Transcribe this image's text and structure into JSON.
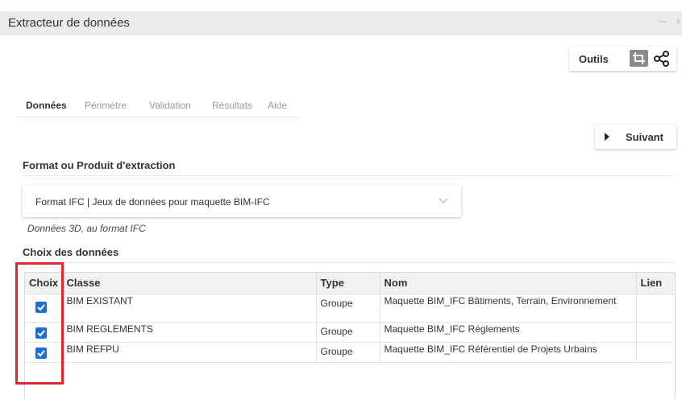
{
  "window": {
    "title": "Extracteur de données",
    "minimize_glyph": "–",
    "close_glyph": "›"
  },
  "toolbar": {
    "outils_label": "Outils",
    "icons": [
      "crop-icon",
      "share-icon"
    ]
  },
  "tabs": [
    {
      "label": "Données",
      "active": true
    },
    {
      "label": "Périmètre",
      "active": false
    },
    {
      "label": "Validation",
      "active": false
    },
    {
      "label": "Résultats",
      "active": false
    },
    {
      "label": "Aide",
      "active": false
    }
  ],
  "navigation": {
    "next_label": "Suivant"
  },
  "format": {
    "section_title": "Format ou Produit d'extraction",
    "selected_value": "Format IFC | Jeux de données pour maquette BIM-IFC",
    "description": "Données 3D, au format IFC"
  },
  "data_choice": {
    "section_title": "Choix des données",
    "columns": {
      "choix": "Choix",
      "classe": "Classe",
      "type": "Type",
      "nom": "Nom",
      "lien": "Lien"
    },
    "rows": [
      {
        "checked": true,
        "classe": "BIM EXISTANT",
        "type": "Groupe",
        "nom": "Maquette BIM_IFC Bâtiments, Terrain, Environnement",
        "lien": ""
      },
      {
        "checked": true,
        "classe": "BIM REGLEMENTS",
        "type": "Groupe",
        "nom": "Maquette BIM_IFC Réglements",
        "lien": ""
      },
      {
        "checked": true,
        "classe": "BIM REFPU",
        "type": "Groupe",
        "nom": "Maquette BIM_IFC Référentiel de Projets Urbains",
        "lien": ""
      }
    ]
  },
  "colors": {
    "checkbox": "#1e6fd4",
    "highlight": "#e0282c",
    "titlebar": "#ebebeb",
    "header_bg": "#f1f1f1"
  }
}
